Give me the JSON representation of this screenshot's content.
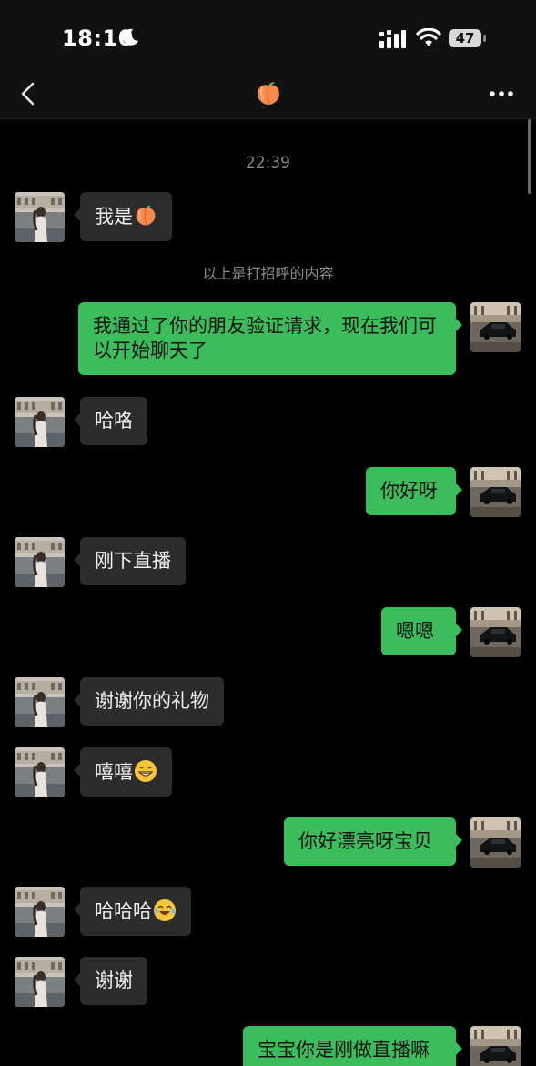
{
  "status_bar": {
    "time": "18:10",
    "battery": "47"
  },
  "header": {
    "title_icon": "peach-emoji"
  },
  "chat": {
    "timestamp": "22:39",
    "system_note": "以上是打招呼的内容",
    "messages": [
      {
        "side": "in",
        "text": "我是",
        "emoji": "peach-emoji"
      },
      {
        "side": "out",
        "text": "我通过了你的朋友验证请求，现在我们可以开始聊天了"
      },
      {
        "side": "in",
        "text": "哈咯"
      },
      {
        "side": "out",
        "text": "你好呀"
      },
      {
        "side": "in",
        "text": "刚下直播"
      },
      {
        "side": "out",
        "text": "嗯嗯"
      },
      {
        "side": "in",
        "text": "谢谢你的礼物"
      },
      {
        "side": "in",
        "text": "嘻嘻",
        "emoji": "grin-emoji"
      },
      {
        "side": "out",
        "text": "你好漂亮呀宝贝"
      },
      {
        "side": "in",
        "text": "哈哈哈",
        "emoji": "tears-of-joy-emoji"
      },
      {
        "side": "in",
        "text": "谢谢"
      },
      {
        "side": "out",
        "text": "宝宝你是刚做直播嘛"
      }
    ]
  },
  "colors": {
    "outgoing_bubble": "#3cbd5c",
    "incoming_bubble": "#2c2c2c",
    "background": "#000000"
  }
}
